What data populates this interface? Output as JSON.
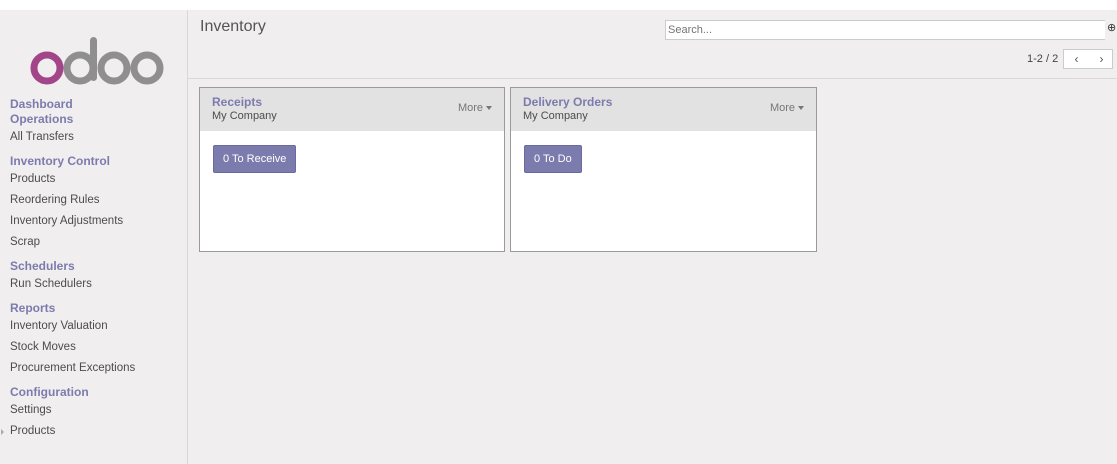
{
  "brand": {
    "logo_text": "odoo",
    "color_primary": "#7c7bad",
    "logo_color": "#875a7b"
  },
  "sidebar": {
    "sections": [
      {
        "title": "Dashboard",
        "items": []
      },
      {
        "title": "Operations",
        "items": [
          "All Transfers"
        ]
      },
      {
        "title": "Inventory Control",
        "items": [
          "Products",
          "Reordering Rules",
          "Inventory Adjustments",
          "Scrap"
        ]
      },
      {
        "title": "Schedulers",
        "items": [
          "Run Schedulers"
        ]
      },
      {
        "title": "Reports",
        "items": [
          "Inventory Valuation",
          "Stock Moves",
          "Procurement Exceptions"
        ]
      },
      {
        "title": "Configuration",
        "items": [
          "Settings",
          "Products"
        ]
      }
    ]
  },
  "header": {
    "title": "Inventory",
    "search_placeholder": "Search...",
    "pager": "1-2 / 2"
  },
  "cards": [
    {
      "title": "Receipts",
      "subtitle": "My Company",
      "more": "More",
      "action": "0 To Receive"
    },
    {
      "title": "Delivery Orders",
      "subtitle": "My Company",
      "more": "More",
      "action": "0 To Do"
    }
  ]
}
